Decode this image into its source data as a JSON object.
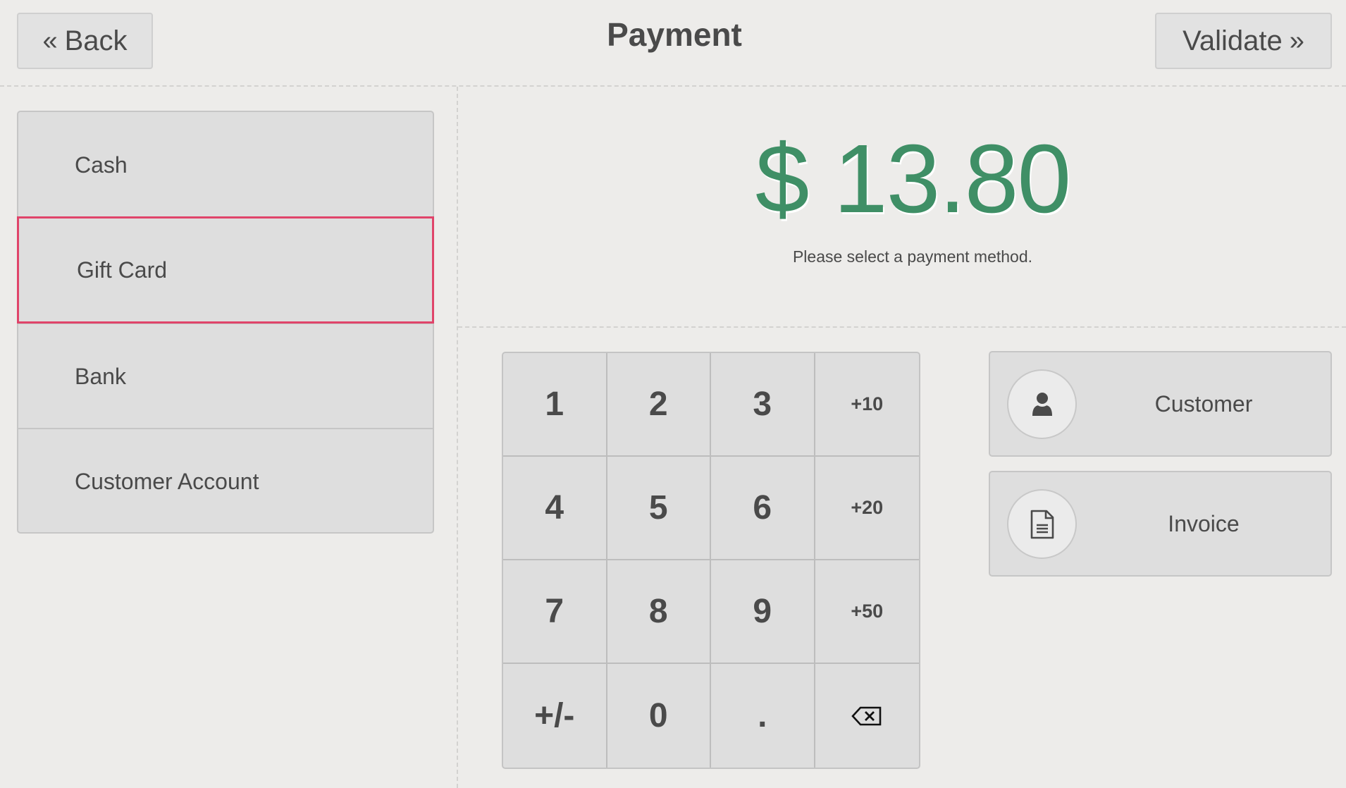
{
  "header": {
    "title": "Payment",
    "back_label": "Back",
    "back_icon": "«",
    "validate_label": "Validate",
    "validate_icon": "»"
  },
  "payment_methods": [
    {
      "label": "Cash",
      "selected": false
    },
    {
      "label": "Gift Card",
      "selected": true
    },
    {
      "label": "Bank",
      "selected": false
    },
    {
      "label": "Customer Account",
      "selected": false
    }
  ],
  "amount": {
    "value": "$ 13.80",
    "hint": "Please select a payment method."
  },
  "numpad": {
    "keys": [
      [
        "1",
        "2",
        "3",
        "+10"
      ],
      [
        "4",
        "5",
        "6",
        "+20"
      ],
      [
        "7",
        "8",
        "9",
        "+50"
      ],
      [
        "+/-",
        "0",
        ".",
        "backspace-icon"
      ]
    ]
  },
  "actions": {
    "customer_label": "Customer",
    "customer_icon": "user-icon",
    "invoice_label": "Invoice",
    "invoice_icon": "document-icon"
  },
  "colors": {
    "amount": "#3f8f66",
    "selected_border": "#e0446a",
    "background": "#edecea",
    "button": "#dedede"
  }
}
